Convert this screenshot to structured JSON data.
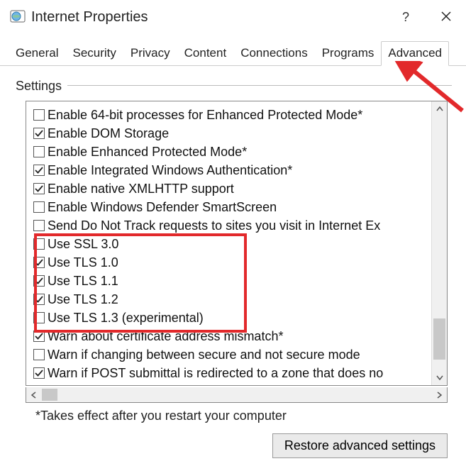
{
  "window": {
    "title": "Internet Properties",
    "help": "?",
    "close": "✕"
  },
  "tabs": {
    "items": [
      {
        "label": "General",
        "active": false
      },
      {
        "label": "Security",
        "active": false
      },
      {
        "label": "Privacy",
        "active": false
      },
      {
        "label": "Content",
        "active": false
      },
      {
        "label": "Connections",
        "active": false
      },
      {
        "label": "Programs",
        "active": false
      },
      {
        "label": "Advanced",
        "active": true
      }
    ]
  },
  "group": {
    "label": "Settings"
  },
  "settings": {
    "items": [
      {
        "checked": false,
        "label": "Enable 64-bit processes for Enhanced Protected Mode*"
      },
      {
        "checked": true,
        "label": "Enable DOM Storage"
      },
      {
        "checked": false,
        "label": "Enable Enhanced Protected Mode*"
      },
      {
        "checked": true,
        "label": "Enable Integrated Windows Authentication*"
      },
      {
        "checked": true,
        "label": "Enable native XMLHTTP support"
      },
      {
        "checked": false,
        "label": "Enable Windows Defender SmartScreen"
      },
      {
        "checked": false,
        "label": "Send Do Not Track requests to sites you visit in Internet Ex"
      },
      {
        "checked": false,
        "label": "Use SSL 3.0"
      },
      {
        "checked": true,
        "label": "Use TLS 1.0"
      },
      {
        "checked": true,
        "label": "Use TLS 1.1"
      },
      {
        "checked": true,
        "label": "Use TLS 1.2"
      },
      {
        "checked": false,
        "label": "Use TLS 1.3 (experimental)"
      },
      {
        "checked": true,
        "label": "Warn about certificate address mismatch*"
      },
      {
        "checked": false,
        "label": "Warn if changing between secure and not secure mode"
      },
      {
        "checked": true,
        "label": "Warn if POST submittal is redirected to a zone that does no"
      }
    ]
  },
  "footnote": "*Takes effect after you restart your computer",
  "buttons": {
    "restore": "Restore advanced settings"
  },
  "annotations": {
    "arrow_color": "#e2292b"
  }
}
